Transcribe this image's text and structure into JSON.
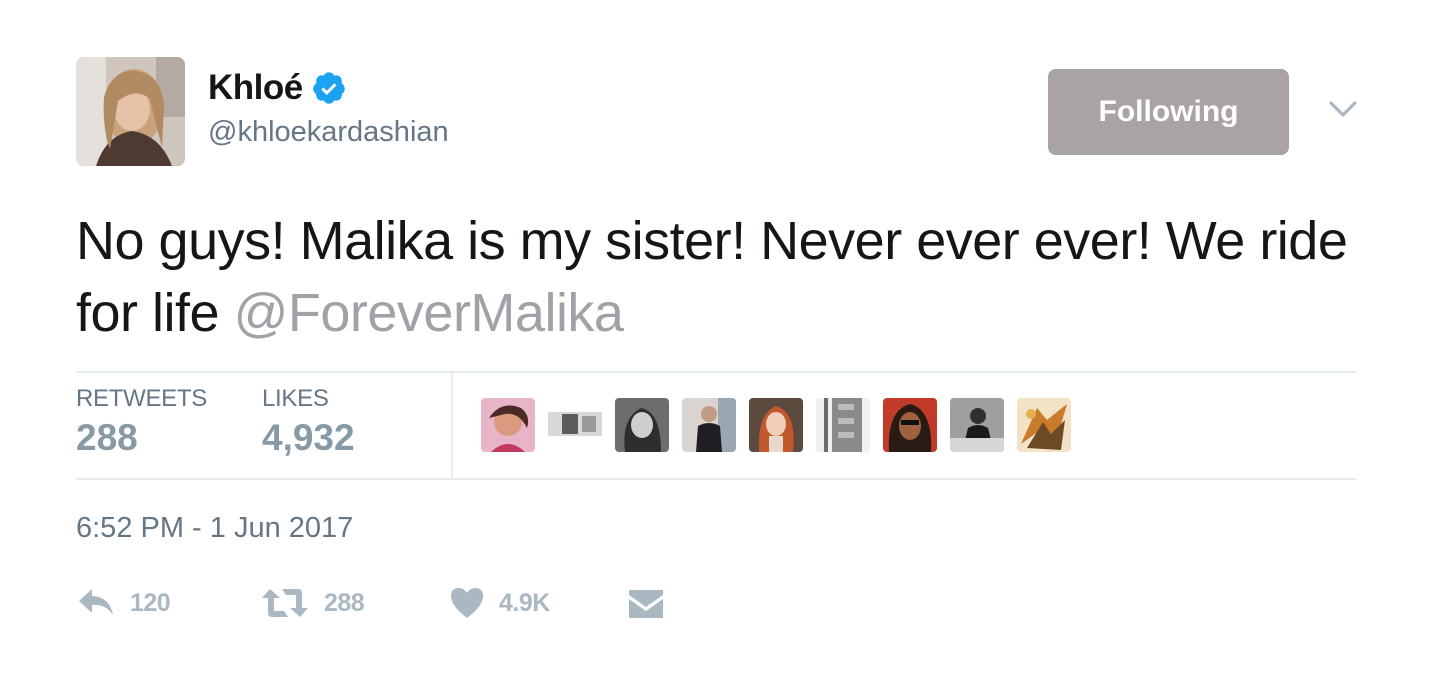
{
  "header": {
    "display_name": "Khloé",
    "handle": "@khloekardashian",
    "follow_button": "Following"
  },
  "tweet": {
    "text_main": "No guys! Malika is my sister! Never ever ever! We ride for life ",
    "mention": "@ForeverMalika"
  },
  "stats": {
    "retweets_label": "RETWEETS",
    "retweets_value": "288",
    "likes_label": "LIKES",
    "likes_value": "4,932"
  },
  "timestamp": "6:52 PM - 1 Jun 2017",
  "actions": {
    "reply_count": "120",
    "retweet_count": "288",
    "like_count": "4.9K"
  },
  "colors": {
    "verified_blue": "#1da1f2",
    "follow_button_bg": "#aaa3a6",
    "action_icon": "#aab8c2"
  },
  "icons": [
    "verified-badge-icon",
    "chevron-down-icon",
    "reply-icon",
    "retweet-icon",
    "heart-icon",
    "envelope-icon"
  ]
}
